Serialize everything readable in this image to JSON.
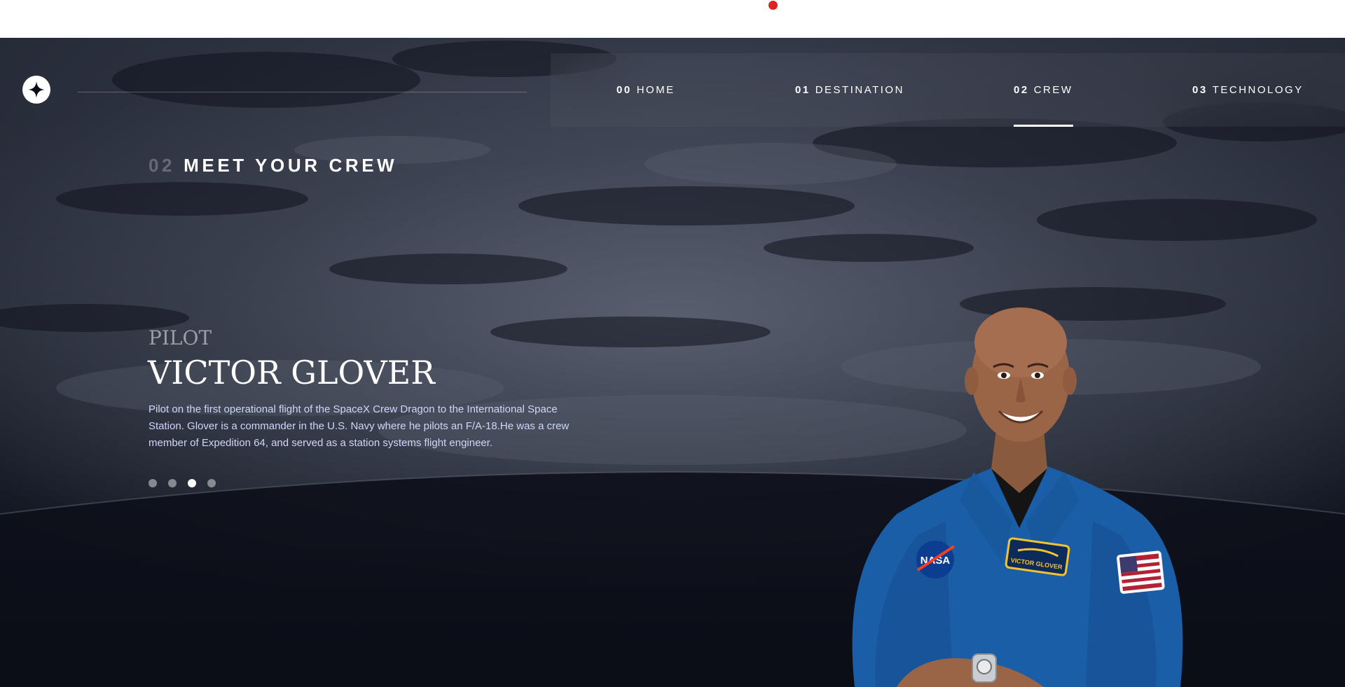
{
  "nav": {
    "items": [
      {
        "num": "00",
        "label": "HOME"
      },
      {
        "num": "01",
        "label": "DESTINATION"
      },
      {
        "num": "02",
        "label": "CREW"
      },
      {
        "num": "03",
        "label": "TECHNOLOGY"
      }
    ],
    "active_index": 2
  },
  "page": {
    "heading_num": "02",
    "heading_text": "MEET YOUR CREW"
  },
  "crew": {
    "role": "Pilot",
    "name": "Victor Glover",
    "bio": "Pilot on the first operational flight of the SpaceX Crew Dragon to the International Space Station. Glover is a commander in the U.S. Navy where he pilots an F/A-18.He was a crew member of Expedition 64, and served as a station systems flight engineer.",
    "slide_count": 4,
    "active_slide": 3,
    "badge_text": "VICTOR GLOVER"
  },
  "colors": {
    "background_dark": "#0b0d17",
    "text_light": "#d0d6f9",
    "accent_red_dot": "#e02424",
    "suit_blue": "#1a5ea8"
  }
}
